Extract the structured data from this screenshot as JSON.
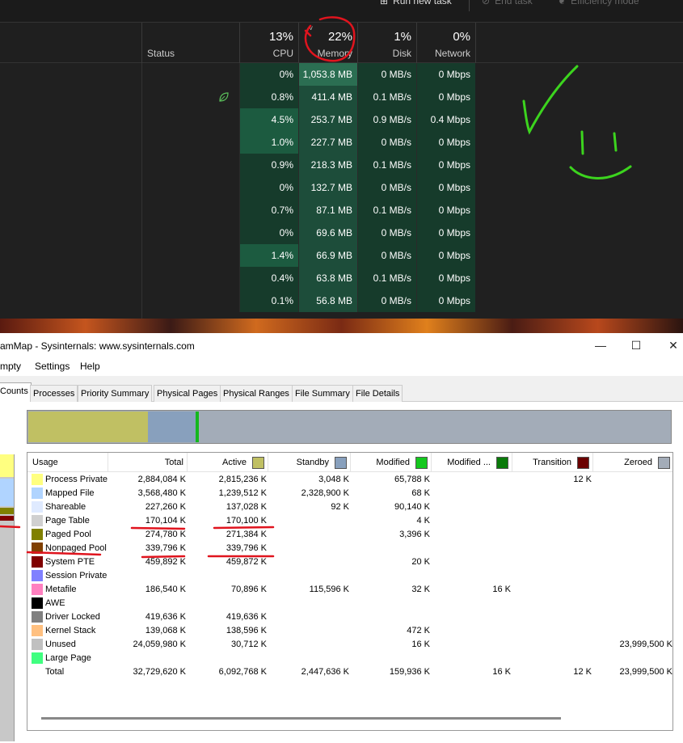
{
  "task_manager": {
    "toolbar": {
      "run_new_task": "Run new task",
      "end_task": "End task",
      "efficiency_mode": "Efficiency mode"
    },
    "headers": {
      "status": "Status",
      "cpu_pct": "13%",
      "cpu_label": "CPU",
      "memory_pct": "22%",
      "memory_label": "Memory",
      "disk_pct": "1%",
      "disk_label": "Disk",
      "network_pct": "0%",
      "network_label": "Network"
    },
    "rows": [
      {
        "cpu": "0%",
        "memory": "1,053.8 MB",
        "disk": "0 MB/s",
        "network": "0 Mbps",
        "efficiency": false
      },
      {
        "cpu": "0.8%",
        "memory": "411.4 MB",
        "disk": "0.1 MB/s",
        "network": "0 Mbps",
        "efficiency": true
      },
      {
        "cpu": "4.5%",
        "memory": "253.7 MB",
        "disk": "0.9 MB/s",
        "network": "0.4 Mbps",
        "efficiency": false
      },
      {
        "cpu": "1.0%",
        "memory": "227.7 MB",
        "disk": "0 MB/s",
        "network": "0 Mbps",
        "efficiency": false
      },
      {
        "cpu": "0.9%",
        "memory": "218.3 MB",
        "disk": "0.1 MB/s",
        "network": "0 Mbps",
        "efficiency": false
      },
      {
        "cpu": "0%",
        "memory": "132.7 MB",
        "disk": "0 MB/s",
        "network": "0 Mbps",
        "efficiency": false
      },
      {
        "cpu": "0.7%",
        "memory": "87.1 MB",
        "disk": "0.1 MB/s",
        "network": "0 Mbps",
        "efficiency": false
      },
      {
        "cpu": "0%",
        "memory": "69.6 MB",
        "disk": "0 MB/s",
        "network": "0 Mbps",
        "efficiency": false
      },
      {
        "cpu": "1.4%",
        "memory": "66.9 MB",
        "disk": "0 MB/s",
        "network": "0 Mbps",
        "efficiency": false
      },
      {
        "cpu": "0.4%",
        "memory": "63.8 MB",
        "disk": "0.1 MB/s",
        "network": "0 Mbps",
        "efficiency": false
      },
      {
        "cpu": "0.1%",
        "memory": "56.8 MB",
        "disk": "0 MB/s",
        "network": "0 Mbps",
        "efficiency": false
      }
    ]
  },
  "rammap": {
    "title": "amMap - Sysinternals: www.sysinternals.com",
    "window_controls": {
      "minimize": "—",
      "maximize": "☐",
      "close": "✕"
    },
    "menu": [
      "mpty",
      "Settings",
      "Help"
    ],
    "tabs": [
      "Counts",
      "Processes",
      "Priority Summary",
      "Physical Pages",
      "Physical Ranges",
      "File Summary",
      "File Details"
    ],
    "active_tab": "Counts",
    "memory_bar": [
      {
        "name": "Active",
        "fraction": 0.186,
        "color": "#c0c063"
      },
      {
        "name": "Standby",
        "fraction": 0.075,
        "color": "#88a0bd"
      },
      {
        "name": "Modified",
        "fraction": 0.005,
        "color": "#14b81e"
      },
      {
        "name": "Zeroed",
        "fraction": 0.734,
        "color": "#a3acb8"
      }
    ],
    "columns": [
      {
        "label": "Usage",
        "color": ""
      },
      {
        "label": "Total",
        "color": ""
      },
      {
        "label": "Active",
        "color": "#c0c063"
      },
      {
        "label": "Standby",
        "color": "#88a0bd"
      },
      {
        "label": "Modified",
        "color": "#14c81e"
      },
      {
        "label": "Modified ...",
        "color": "#0a7a0a"
      },
      {
        "label": "Transition",
        "color": "#6b0000"
      },
      {
        "label": "Zeroed",
        "color": "#a3acb8"
      }
    ],
    "rows": [
      {
        "usage": "Process Private",
        "color": "#ffff80",
        "total": "2,884,084 K",
        "active": "2,815,236 K",
        "standby": "3,048 K",
        "modified": "65,788 K",
        "modified_no_write": "",
        "transition": "12 K",
        "zeroed": ""
      },
      {
        "usage": "Mapped File",
        "color": "#b0d4ff",
        "total": "3,568,480 K",
        "active": "1,239,512 K",
        "standby": "2,328,900 K",
        "modified": "68 K",
        "modified_no_write": "",
        "transition": "",
        "zeroed": ""
      },
      {
        "usage": "Shareable",
        "color": "#dfeaff",
        "total": "227,260 K",
        "active": "137,028 K",
        "standby": "92 K",
        "modified": "90,140 K",
        "modified_no_write": "",
        "transition": "",
        "zeroed": ""
      },
      {
        "usage": "Page Table",
        "color": "#d0d0d0",
        "total": "170,104 K",
        "active": "170,100 K",
        "standby": "",
        "modified": "4 K",
        "modified_no_write": "",
        "transition": "",
        "zeroed": ""
      },
      {
        "usage": "Paged Pool",
        "color": "#808000",
        "total": "274,780 K",
        "active": "271,384 K",
        "standby": "",
        "modified": "3,396 K",
        "modified_no_write": "",
        "transition": "",
        "zeroed": ""
      },
      {
        "usage": "Nonpaged Pool",
        "color": "#804000",
        "total": "339,796 K",
        "active": "339,796 K",
        "standby": "",
        "modified": "",
        "modified_no_write": "",
        "transition": "",
        "zeroed": ""
      },
      {
        "usage": "System PTE",
        "color": "#800000",
        "total": "459,892 K",
        "active": "459,872 K",
        "standby": "",
        "modified": "20 K",
        "modified_no_write": "",
        "transition": "",
        "zeroed": ""
      },
      {
        "usage": "Session Private",
        "color": "#8080ff",
        "total": "",
        "active": "",
        "standby": "",
        "modified": "",
        "modified_no_write": "",
        "transition": "",
        "zeroed": ""
      },
      {
        "usage": "Metafile",
        "color": "#ff80c0",
        "total": "186,540 K",
        "active": "70,896 K",
        "standby": "115,596 K",
        "modified": "32 K",
        "modified_no_write": "16 K",
        "transition": "",
        "zeroed": ""
      },
      {
        "usage": "AWE",
        "color": "#000000",
        "total": "",
        "active": "",
        "standby": "",
        "modified": "",
        "modified_no_write": "",
        "transition": "",
        "zeroed": ""
      },
      {
        "usage": "Driver Locked",
        "color": "#808080",
        "total": "419,636 K",
        "active": "419,636 K",
        "standby": "",
        "modified": "",
        "modified_no_write": "",
        "transition": "",
        "zeroed": ""
      },
      {
        "usage": "Kernel Stack",
        "color": "#ffc080",
        "total": "139,068 K",
        "active": "138,596 K",
        "standby": "",
        "modified": "472 K",
        "modified_no_write": "",
        "transition": "",
        "zeroed": ""
      },
      {
        "usage": "Unused",
        "color": "#c0c0c0",
        "total": "24,059,980 K",
        "active": "30,712 K",
        "standby": "",
        "modified": "16 K",
        "modified_no_write": "",
        "transition": "",
        "zeroed": "23,999,500 K"
      },
      {
        "usage": "Large Page",
        "color": "#40ff80",
        "total": "",
        "active": "",
        "standby": "",
        "modified": "",
        "modified_no_write": "",
        "transition": "",
        "zeroed": ""
      },
      {
        "usage": "Total",
        "color": "",
        "total": "32,729,620 K",
        "active": "6,092,768 K",
        "standby": "2,447,636 K",
        "modified": "159,936 K",
        "modified_no_write": "16 K",
        "transition": "12 K",
        "zeroed": "23,999,500 K"
      }
    ]
  },
  "colors": {
    "annotation_red": "#e0141e",
    "annotation_green": "#3cd41e"
  }
}
